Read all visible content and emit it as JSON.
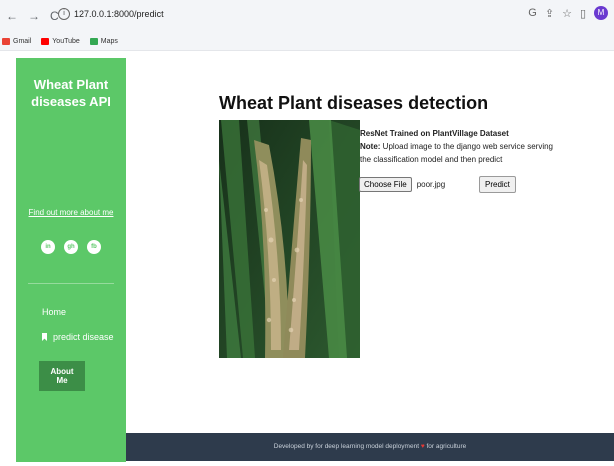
{
  "browser": {
    "back_glyph": "←",
    "forward_glyph": "→",
    "reload_glyph": "C",
    "url": "127.0.0.1:8000/predict",
    "profile_initial": "M",
    "bookmarks": [
      {
        "label": "Gmail",
        "color": "#ea4335"
      },
      {
        "label": "YouTube",
        "color": "#ff0000"
      },
      {
        "label": "Maps",
        "color": "#34a853"
      }
    ]
  },
  "sidebar": {
    "title": "Wheat Plant diseases API",
    "find_link": "Find out more about me",
    "socials": [
      "in",
      "gh",
      "fb"
    ],
    "nav": {
      "home": "Home",
      "predict": "predict disease"
    },
    "about_button": "About Me",
    "bg_color": "#5cc868"
  },
  "main": {
    "title": "Wheat Plant diseases detection",
    "model_line": "ResNet Trained on PlantVillage Dataset",
    "note_label": "Note:",
    "note_text": " Upload image to the django web service serving the classification model and then predict",
    "choose_button": "Choose File",
    "file_name": "poor.jpg",
    "predict_button": "Predict"
  },
  "footer": {
    "text_before": "Developed by for deep learning model deployment ",
    "heart": "♥",
    "text_after": " for agriculture"
  }
}
